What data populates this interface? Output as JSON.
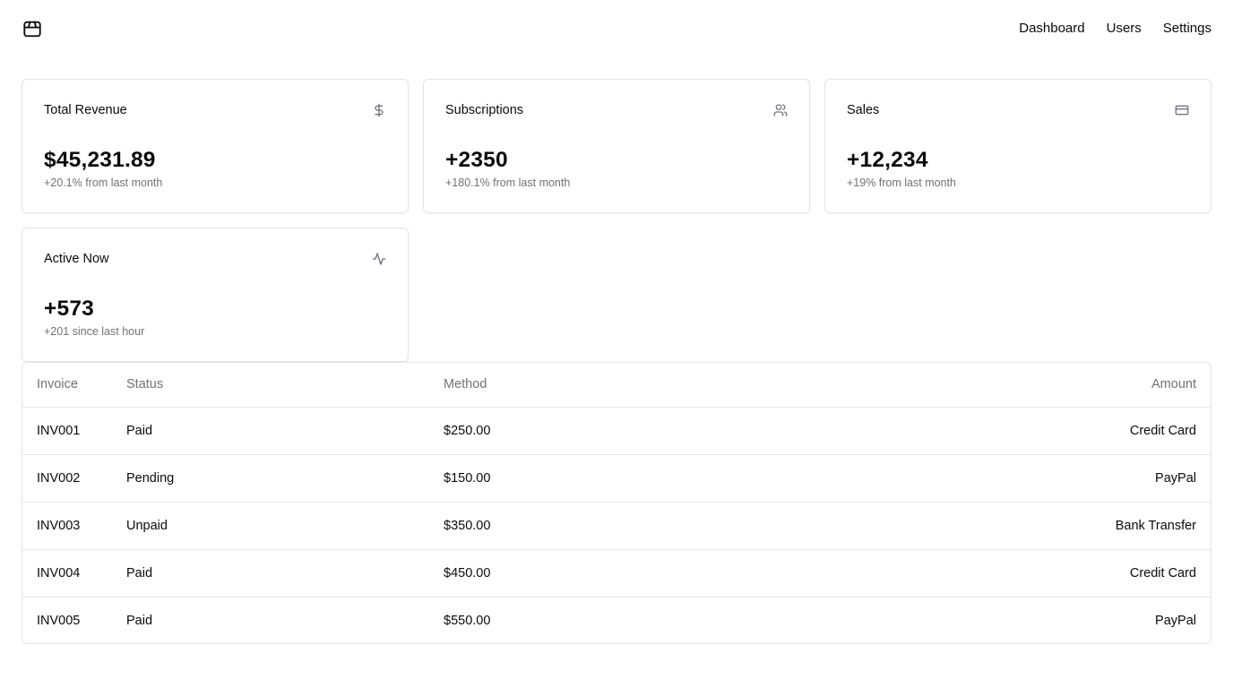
{
  "header": {
    "logo_icon": "package-icon",
    "nav": [
      {
        "label": "Dashboard"
      },
      {
        "label": "Users"
      },
      {
        "label": "Settings"
      }
    ]
  },
  "cards": [
    {
      "title": "Total Revenue",
      "icon": "dollar-sign-icon",
      "value": "$45,231.89",
      "subtitle": "+20.1% from last month"
    },
    {
      "title": "Subscriptions",
      "icon": "users-icon",
      "value": "+2350",
      "subtitle": "+180.1% from last month"
    },
    {
      "title": "Sales",
      "icon": "credit-card-icon",
      "value": "+12,234",
      "subtitle": "+19% from last month"
    },
    {
      "title": "Active Now",
      "icon": "activity-icon",
      "value": "+573",
      "subtitle": "+201 since last hour"
    }
  ],
  "table": {
    "headers": {
      "invoice": "Invoice",
      "status": "Status",
      "method": "Method",
      "amount": "Amount"
    },
    "rows": [
      {
        "invoice": "INV001",
        "status": "Paid",
        "method": "$250.00",
        "amount": "Credit Card"
      },
      {
        "invoice": "INV002",
        "status": "Pending",
        "method": "$150.00",
        "amount": "PayPal"
      },
      {
        "invoice": "INV003",
        "status": "Unpaid",
        "method": "$350.00",
        "amount": "Bank Transfer"
      },
      {
        "invoice": "INV004",
        "status": "Paid",
        "method": "$450.00",
        "amount": "Credit Card"
      },
      {
        "invoice": "INV005",
        "status": "Paid",
        "method": "$550.00",
        "amount": "PayPal"
      }
    ]
  },
  "colors": {
    "muted_text": "#71717a",
    "border": "#e4e4e7",
    "foreground": "#0a0a0a"
  }
}
